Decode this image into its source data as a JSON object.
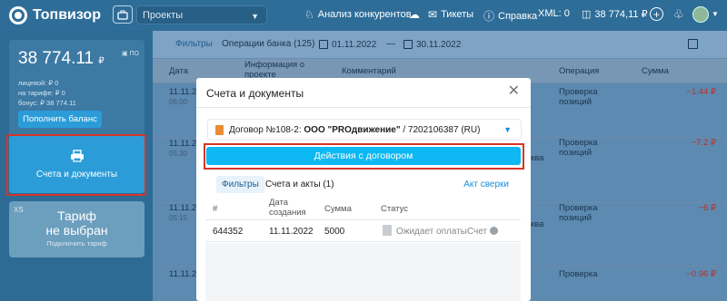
{
  "topbar": {
    "logo_text": "Топвизор",
    "project_select": "Проекты",
    "nav": {
      "competitors": "Анализ конкурентов",
      "tickets": "Тикеты",
      "help": "Справка"
    },
    "xml": "XML: 0",
    "balance": "38 774,11 ₽"
  },
  "sidebar": {
    "balance_main": "38 774.11",
    "balance_currency": "₽",
    "balance_badge": "ПО",
    "lines": [
      "лицевой:    ₽ 0",
      "на тарифе: ₽ 0",
      "бонус: ₽ 38 774.11"
    ],
    "topup_label": "Пополнить баланс",
    "docs_label": "Счета и документы",
    "tariff_size": "XS",
    "tariff_title_1": "Тариф",
    "tariff_title_2": "не выбран",
    "tariff_link": "Подключить тариф"
  },
  "main": {
    "filters": "Фильтры",
    "bank_ops": "Операции банка",
    "bank_ops_count": "(125)",
    "date_from": "01.11.2022",
    "date_sep": "—",
    "date_to": "30.11.2022",
    "columns": {
      "date": "Дата",
      "info_1": "Информация о",
      "info_2": "проекте",
      "comment": "Комментарий",
      "operation": "Операция",
      "sum": "Сумма"
    },
    "rows": [
      {
        "date": "11.11.20",
        "time": "06:00",
        "op1": "Проверка",
        "op2": "позиций",
        "sum": "−1.44 ₽",
        "note": ""
      },
      {
        "date": "11.11.20",
        "time": "05:30",
        "op1": "Проверка",
        "op2": "позиций",
        "sum": "−7.2 ₽",
        "note": "ква"
      },
      {
        "date": "11.11.20",
        "time": "05:15",
        "op1": "Проверка",
        "op2": "позиций",
        "sum": "−6 ₽",
        "note": "ква"
      },
      {
        "date": "11.11.20",
        "time": "",
        "op1": "Проверка",
        "op2": "",
        "sum": "−0.96 ₽",
        "note": ""
      }
    ]
  },
  "modal": {
    "title": "Счета и документы",
    "contract_prefix": "Договор №108-2:",
    "contract_company": "ООО \"PROдвижение\"",
    "contract_inn": "/ 7202106387 (RU)",
    "action_button": "Действия с договором",
    "tab_filters": "Фильтры",
    "tab_invoices": "Счета и акты",
    "tab_invoices_count": "(1)",
    "reconcile_link": "Акт сверки",
    "columns": {
      "num": "#",
      "date_1": "Дата",
      "date_2": "создания",
      "sum": "Сумма",
      "status": "Статус"
    },
    "row": {
      "num": "644352",
      "date": "11.11.2022",
      "sum": "5000",
      "status": "Ожидает оплаты",
      "doc": "Счет"
    }
  }
}
